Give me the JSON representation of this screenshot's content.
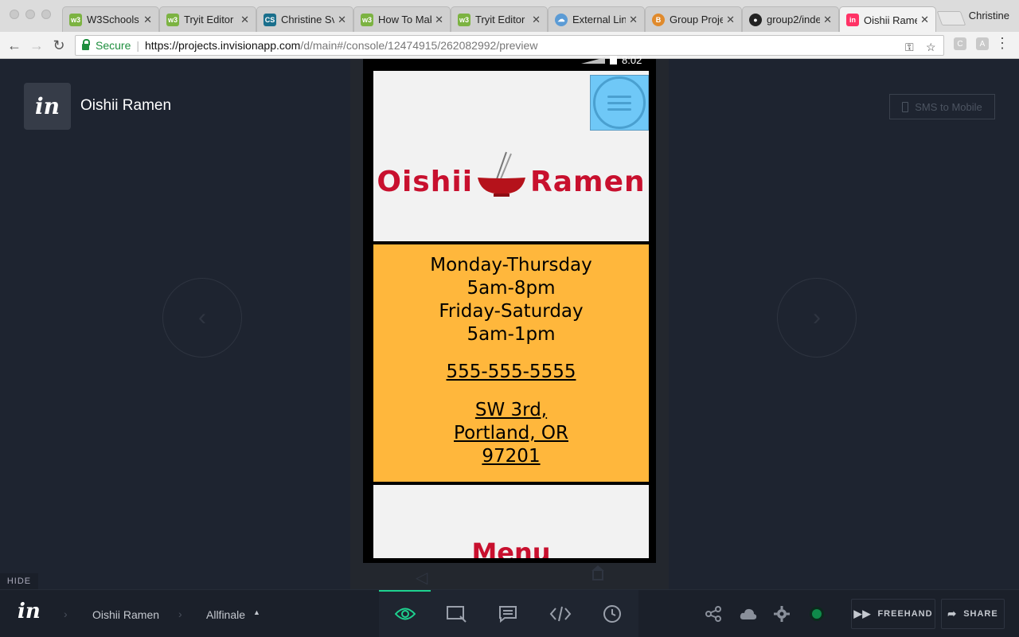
{
  "browser": {
    "tabs": [
      {
        "title": "W3Schools",
        "favicon": "w3",
        "color": "#7cb342"
      },
      {
        "title": "Tryit Editor",
        "favicon": "w3",
        "color": "#7cb342"
      },
      {
        "title": "Christine Sv",
        "favicon": "CS",
        "color": "#1a6f8c"
      },
      {
        "title": "How To Mak",
        "favicon": "w3",
        "color": "#7cb342"
      },
      {
        "title": "Tryit Editor",
        "favicon": "w3",
        "color": "#7cb342"
      },
      {
        "title": "External Lin",
        "favicon": "cloud",
        "color": "#5b9bd5"
      },
      {
        "title": "Group Proje",
        "favicon": "B",
        "color": "#e08a2c"
      },
      {
        "title": "group2/inde",
        "favicon": "gh",
        "color": "#222222"
      },
      {
        "title": "Oishii Rame",
        "favicon": "in",
        "color": "#ff3366"
      }
    ],
    "profile_name": "Christine",
    "secure_label": "Secure",
    "url_host": "https://projects.invisionapp.com",
    "url_rest": "/d/main#/console/12474915/262082992/preview"
  },
  "invision": {
    "project_title": "Oishii Ramen",
    "sms_button": "SMS to Mobile",
    "hide_label": "HIDE",
    "logo_text": "in",
    "breadcrumb": {
      "project": "Oishii Ramen",
      "screen": "Allfinale"
    },
    "freehand_label": "FREEHAND",
    "share_label": "SHARE"
  },
  "device": {
    "time": "8:02"
  },
  "prototype": {
    "logo_left": "Oishii",
    "logo_right": "Ramen",
    "hours": [
      "Monday-Thursday",
      "5am-8pm",
      "Friday-Saturday",
      "5am-1pm"
    ],
    "phone": "555-555-5555",
    "address": [
      "SW 3rd,",
      "Portland, OR",
      "97201"
    ],
    "menu_heading": "Menu"
  },
  "colors": {
    "accent_green": "#1ed18f",
    "info_bg": "#ffb73c",
    "brand_red": "#c8102e",
    "menu_button": "#6fc8f7"
  }
}
